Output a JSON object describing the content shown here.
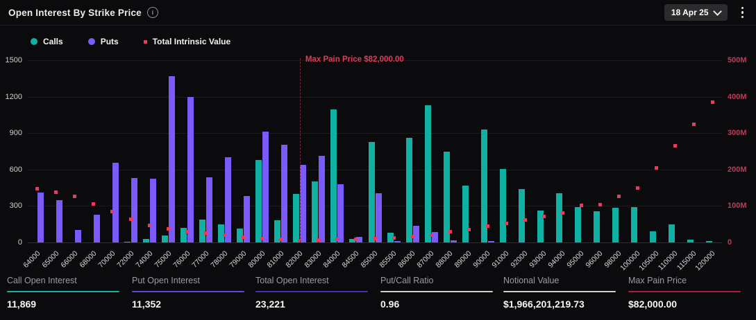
{
  "header": {
    "title": "Open Interest By Strike Price",
    "date_selector": "18 Apr 25"
  },
  "legend": [
    {
      "label": "Calls",
      "color": "#10b0a2",
      "marker": "circle"
    },
    {
      "label": "Puts",
      "color": "#7a5af8",
      "marker": "circle"
    },
    {
      "label": "Total Intrinsic Value",
      "color": "#ea3b5f",
      "marker": "square"
    }
  ],
  "chart_data": {
    "type": "bar",
    "title": "Open Interest By Strike Price",
    "categories": [
      "64000",
      "65000",
      "66000",
      "68000",
      "70000",
      "72000",
      "74000",
      "75000",
      "76000",
      "77000",
      "78000",
      "79000",
      "80000",
      "81000",
      "82000",
      "83000",
      "84000",
      "84500",
      "85000",
      "85500",
      "86000",
      "87000",
      "88000",
      "89000",
      "90000",
      "91000",
      "92000",
      "93000",
      "94000",
      "95000",
      "96000",
      "98000",
      "100000",
      "105000",
      "110000",
      "115000",
      "120000"
    ],
    "series": [
      {
        "name": "Calls",
        "type": "bar",
        "axis": "left",
        "color": "#10b0a2",
        "values": [
          0,
          0,
          0,
          0,
          0,
          5,
          30,
          55,
          120,
          190,
          150,
          115,
          680,
          180,
          400,
          500,
          1095,
          30,
          825,
          80,
          860,
          1130,
          750,
          465,
          930,
          605,
          440,
          260,
          405,
          290,
          255,
          285,
          290,
          90,
          150,
          20,
          10
        ]
      },
      {
        "name": "Puts",
        "type": "bar",
        "axis": "left",
        "color": "#7a5af8",
        "values": [
          410,
          350,
          100,
          230,
          655,
          530,
          525,
          1370,
          1200,
          535,
          700,
          380,
          915,
          805,
          640,
          715,
          480,
          45,
          405,
          10,
          135,
          85,
          15,
          0,
          10,
          0,
          0,
          0,
          0,
          0,
          0,
          0,
          0,
          0,
          0,
          0,
          0
        ]
      },
      {
        "name": "Total Intrinsic Value",
        "type": "scatter",
        "axis": "right",
        "color": "#ea3b5f",
        "values_millions": [
          148,
          137,
          127,
          105,
          84,
          64,
          46,
          38,
          30,
          25,
          20,
          15,
          11,
          8,
          5,
          6,
          8,
          9,
          11,
          13,
          16,
          20,
          30,
          35,
          44,
          53,
          61,
          72,
          80,
          101,
          104,
          127,
          150,
          205,
          265,
          325,
          385
        ]
      }
    ],
    "left_axis": {
      "ticks": [
        0,
        300,
        600,
        900,
        1200,
        1500
      ],
      "lim": [
        0,
        1500
      ]
    },
    "right_axis": {
      "ticks": [
        "0",
        "100M",
        "200M",
        "300M",
        "400M",
        "500M"
      ],
      "lim_millions": [
        0,
        500
      ]
    },
    "annotation": {
      "label": "Max Pain Price $82,000.00",
      "category": "82000"
    },
    "grid": true,
    "legend_position": "top-left"
  },
  "stats": [
    {
      "label": "Call Open Interest",
      "value": "11,869",
      "underline": "#16b3a2"
    },
    {
      "label": "Put Open Interest",
      "value": "11,352",
      "underline": "#5b4bd6"
    },
    {
      "label": "Total Open Interest",
      "value": "23,221",
      "underline": "#3d35b8"
    },
    {
      "label": "Put/Call Ratio",
      "value": "0.96",
      "underline": "#cfcfcf"
    },
    {
      "label": "Notional Value",
      "value": "$1,966,201,219.73",
      "underline": "#cfcfcf"
    },
    {
      "label": "Max Pain Price",
      "value": "$82,000.00",
      "underline": "#aa1f44"
    }
  ]
}
